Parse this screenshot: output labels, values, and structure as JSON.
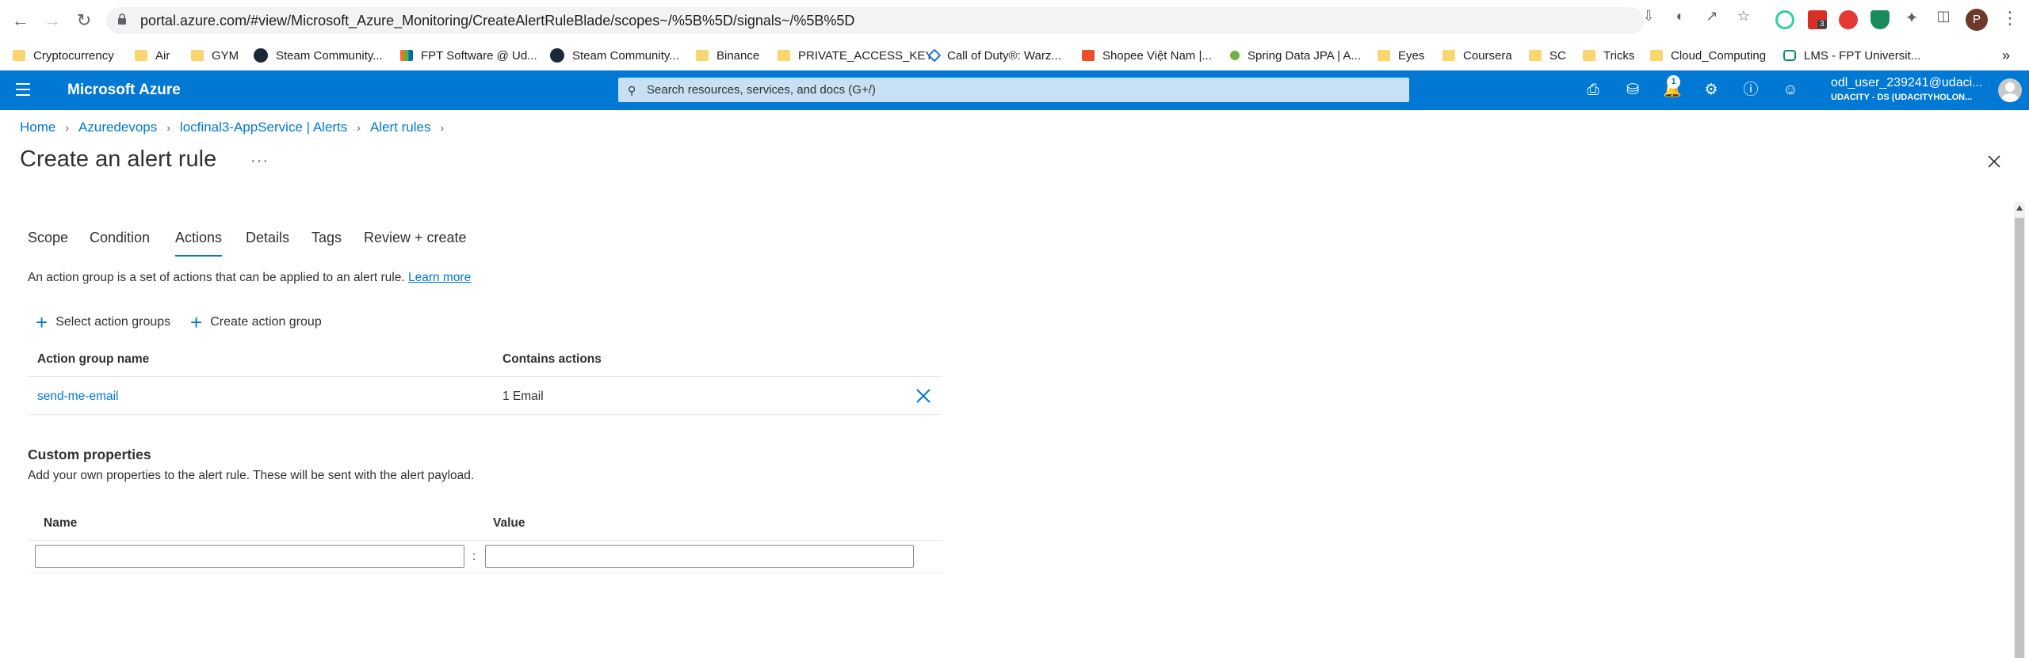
{
  "browser": {
    "url": "portal.azure.com/#view/Microsoft_Azure_Monitoring/CreateAlertRuleBlade/scopes~/%5B%5D/signals~/%5B%5D",
    "profile_initial": "P",
    "extension_badge": "3",
    "bookmarks": [
      {
        "label": "Cryptocurrency",
        "icon": "folder"
      },
      {
        "label": "Air",
        "icon": "folder"
      },
      {
        "label": "GYM",
        "icon": "folder"
      },
      {
        "label": "Steam Community...",
        "icon": "steam"
      },
      {
        "label": "FPT Software @ Ud...",
        "icon": "fpt"
      },
      {
        "label": "Steam Community...",
        "icon": "steam"
      },
      {
        "label": "Binance",
        "icon": "folder"
      },
      {
        "label": "PRIVATE_ACCESS_KEY",
        "icon": "folder"
      },
      {
        "label": "Call of Duty®: Warz...",
        "icon": "cod"
      },
      {
        "label": "Shopee Việt Nam |...",
        "icon": "shopee"
      },
      {
        "label": "Spring Data JPA | A...",
        "icon": "spring"
      },
      {
        "label": "Eyes",
        "icon": "folder"
      },
      {
        "label": "Coursera",
        "icon": "folder"
      },
      {
        "label": "SC",
        "icon": "folder"
      },
      {
        "label": "Tricks",
        "icon": "folder"
      },
      {
        "label": "Cloud_Computing",
        "icon": "folder"
      },
      {
        "label": "LMS - FPT Universit...",
        "icon": "lms"
      }
    ]
  },
  "header": {
    "brand": "Microsoft Azure",
    "search_placeholder": "Search resources, services, and docs (G+/)",
    "notification_count": "1",
    "user_name": "odl_user_239241@udaci...",
    "user_tenant": "UDACITY - DS (UDACITYHOLON..."
  },
  "breadcrumb": [
    "Home",
    "Azuredevops",
    "locfinal3-AppService | Alerts",
    "Alert rules"
  ],
  "page": {
    "title": "Create an alert rule",
    "more": "···"
  },
  "tabs": [
    "Scope",
    "Condition",
    "Actions",
    "Details",
    "Tags",
    "Review + create"
  ],
  "active_tab": "Actions",
  "actions": {
    "intro": "An action group is a set of actions that can be applied to an alert rule.",
    "learn_more": "Learn more",
    "select_label": "Select action groups",
    "create_label": "Create action group",
    "columns": [
      "Action group name",
      "Contains actions"
    ],
    "rows": [
      {
        "name": "send-me-email",
        "contains": "1 Email"
      }
    ]
  },
  "custom_properties": {
    "title": "Custom properties",
    "description": "Add your own properties to the alert rule. These will be sent with the alert payload.",
    "columns": [
      "Name",
      "Value"
    ],
    "name_value": "",
    "value_value": "",
    "separator": ":"
  },
  "colors": {
    "azure_blue": "#0078d4",
    "search_bg": "#c7e0f4"
  }
}
